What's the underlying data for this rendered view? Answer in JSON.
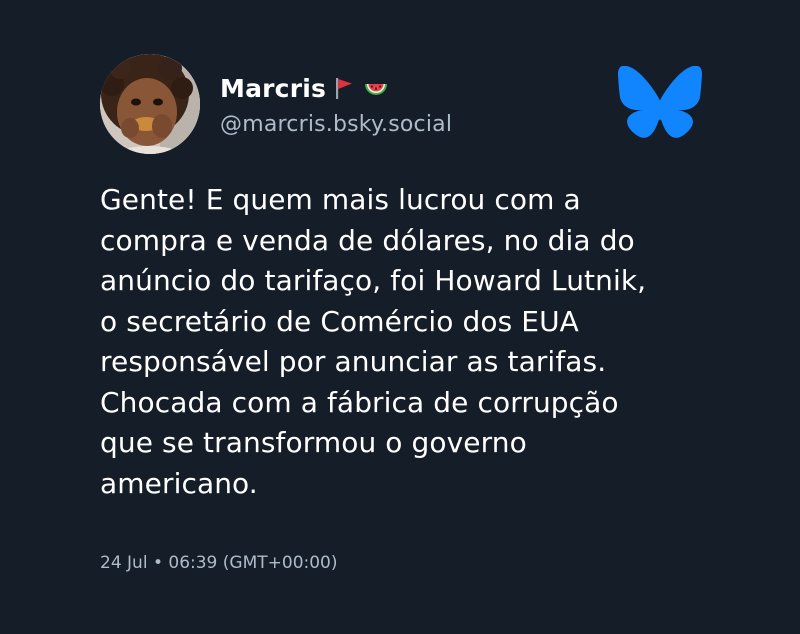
{
  "post": {
    "author": {
      "display_name": "Marcris",
      "name_emojis": [
        "red-flag-icon",
        "watermelon-icon"
      ],
      "handle": "@marcris.bsky.social",
      "avatar": "child-avatar-photo"
    },
    "text": "Gente! E quem mais lucrou com a\ncompra e venda de dólares, no dia do\nanúncio do tarifaço, foi Howard Lutnik,\no secretário de Comércio dos EUA\nresponsável por anunciar as tarifas.\nChocada com a fábrica de corrupção\nque se transformou o governo\namericano.",
    "timestamp": "24 Jul • 06:39 (GMT+00:00)"
  },
  "brand": {
    "logo": "bluesky-butterfly-icon",
    "logo_color": "#1185fe"
  },
  "colors": {
    "background": "#151d28",
    "primary_text": "#ffffff",
    "secondary_text": "#aebbc9"
  }
}
